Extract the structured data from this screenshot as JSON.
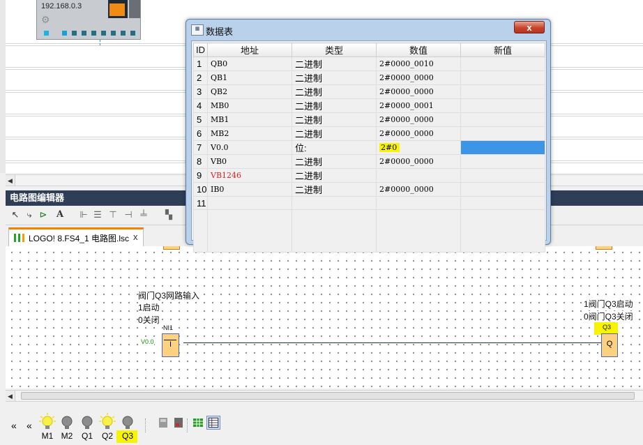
{
  "device": {
    "ip": "192.168.0.3"
  },
  "editor": {
    "title": "电路图编辑器",
    "tab_label": "LOGO! 8.FS4_1 电路图.lsc",
    "tab_close": "x"
  },
  "canvas": {
    "left_note": [
      "阀门Q3网路输入",
      "1启动",
      "0关闭"
    ],
    "left_block_label": "NI1",
    "left_block_input": "V0.0",
    "left_block_symbol": "I",
    "right_note": [
      "1阀门Q3启动",
      "0阀门Q3关闭"
    ],
    "right_block_label": "Q3",
    "right_block_symbol": "Q"
  },
  "bottom": {
    "nav_first": "«",
    "nav_prev": "«",
    "outputs": [
      {
        "label": "M1",
        "on": true
      },
      {
        "label": "M2",
        "on": false
      },
      {
        "label": "Q1",
        "on": false
      },
      {
        "label": "Q2",
        "on": true
      },
      {
        "label": "Q3",
        "on": false,
        "highlight": true
      }
    ]
  },
  "dialog": {
    "title": "数据表",
    "close": "x",
    "columns": [
      "ID",
      "地址",
      "类型",
      "数值",
      "新值"
    ],
    "rows": [
      {
        "id": "1",
        "address": "QB0",
        "type": "二进制",
        "value": "2#0000_0010",
        "new": ""
      },
      {
        "id": "2",
        "address": "QB1",
        "type": "二进制",
        "value": "2#0000_0000",
        "new": ""
      },
      {
        "id": "3",
        "address": "QB2",
        "type": "二进制",
        "value": "2#0000_0000",
        "new": ""
      },
      {
        "id": "4",
        "address": "MB0",
        "type": "二进制",
        "value": "2#0000_0001",
        "new": ""
      },
      {
        "id": "5",
        "address": "MB1",
        "type": "二进制",
        "value": "2#0000_0000",
        "new": ""
      },
      {
        "id": "6",
        "address": "MB2",
        "type": "二进制",
        "value": "2#0000_0000",
        "new": ""
      },
      {
        "id": "7",
        "address": "V0.0",
        "type": "位:",
        "value": "2#0",
        "new": ""
      },
      {
        "id": "8",
        "address": "VB0",
        "type": "二进制",
        "value": "2#0000_0000",
        "new": ""
      },
      {
        "id": "9",
        "address": "VB1246",
        "type": "二进制",
        "value": "",
        "new": ""
      },
      {
        "id": "10",
        "address": "IB0",
        "type": "二进制",
        "value": "2#0000_0000",
        "new": ""
      },
      {
        "id": "11",
        "address": "",
        "type": "",
        "value": "",
        "new": ""
      }
    ]
  },
  "colors": {
    "title_bar": "#2e3e57",
    "tab_accent": "#f08300",
    "highlight_yellow": "#f8f400",
    "selected_cell": "#3d95e6",
    "error_red": "#e01e1e"
  }
}
